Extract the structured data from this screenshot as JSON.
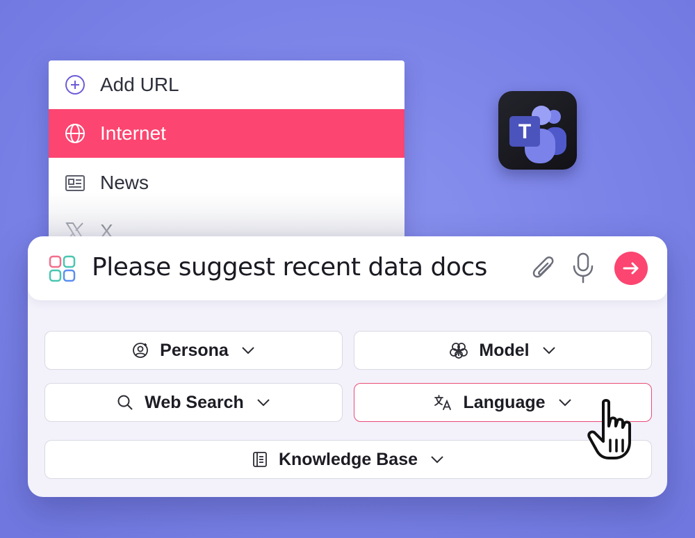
{
  "menu": {
    "items": [
      {
        "label": "Add URL",
        "icon": "plus-circle-icon"
      },
      {
        "label": "Internet",
        "icon": "globe-icon",
        "active": true
      },
      {
        "label": "News",
        "icon": "newspaper-icon"
      },
      {
        "label": "X",
        "icon": "x-logo-icon"
      }
    ]
  },
  "prompt": {
    "text": "Please suggest recent data docs"
  },
  "options": {
    "persona": "Persona",
    "model": "Model",
    "web_search": "Web Search",
    "language": "Language",
    "knowledge_base": "Knowledge Base"
  },
  "app_icon": {
    "letter": "T",
    "name": "teams-app-icon"
  },
  "colors": {
    "background": "#7b83e8",
    "active_item": "#fc4570",
    "send_button": "#fc4570",
    "language_border": "#ea4a75",
    "teams_purple": "#5b5fc7"
  }
}
